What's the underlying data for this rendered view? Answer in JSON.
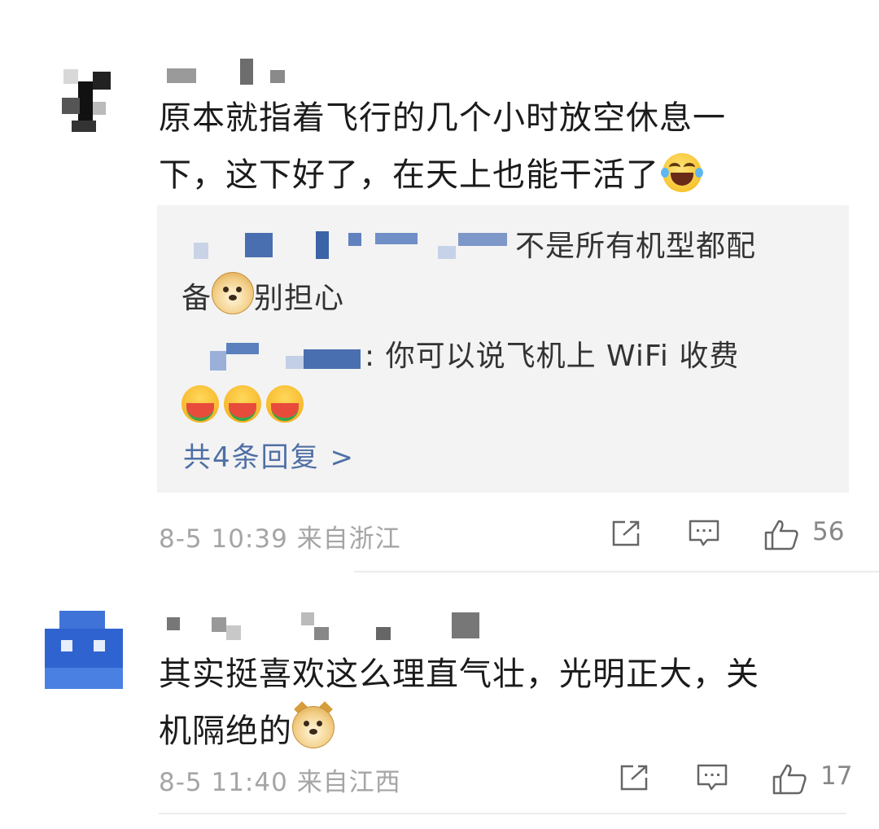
{
  "comments": [
    {
      "text_line1": "原本就指着飞行的几个小时放空休息一",
      "text_line2": "下，这下好了，在天上也能干活了",
      "emoji": "laughing-tears-icon",
      "replies": [
        {
          "text_line1": "不是所有机型都配",
          "text_line2_a": "备",
          "text_line2_b": "别担心",
          "emoji": "doge-icon"
        },
        {
          "text": ": 你可以说飞机上 WiFi 收费",
          "emoji": "watermelon-eating-icon",
          "emoji_count": 3
        }
      ],
      "more_replies": "共4条回复 >",
      "time": "8-5 10:39",
      "location": "来自浙江",
      "likes": "56"
    },
    {
      "text_line1": "其实挺喜欢这么理直气壮，光明正大，关",
      "text_line2": "机隔绝的",
      "emoji": "doge-icon",
      "time": "8-5 11:40",
      "location": "来自江西",
      "likes": "17"
    }
  ],
  "colors": {
    "link": "#4f6fa6",
    "meta": "#a5a5a5",
    "reply_bg": "#f3f3f3"
  }
}
